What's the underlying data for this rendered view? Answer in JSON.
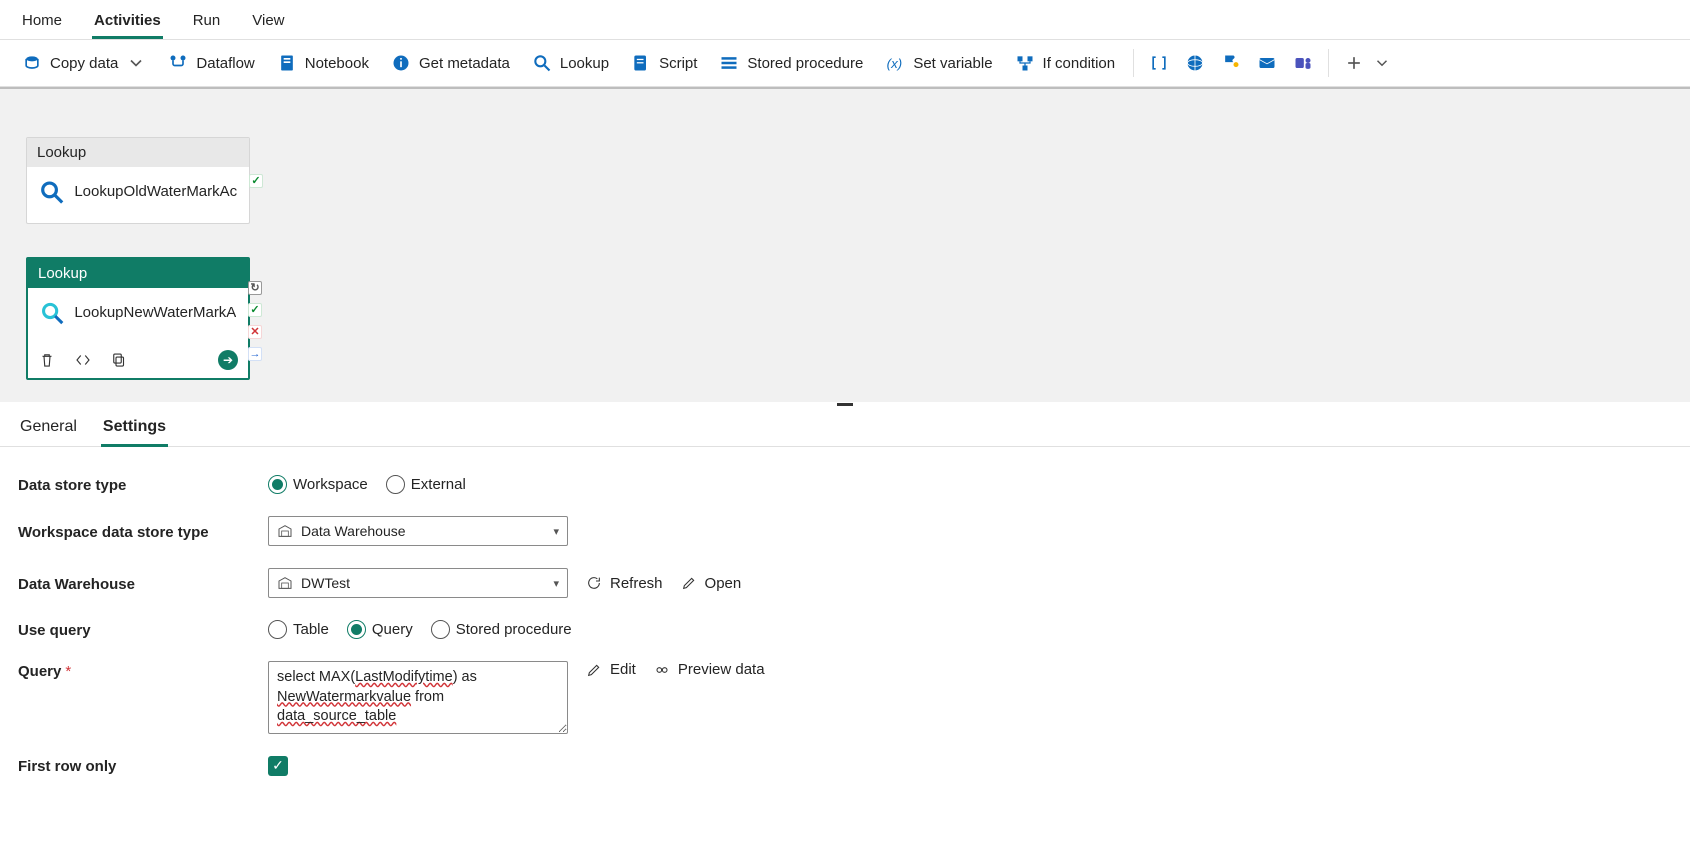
{
  "topTabs": {
    "home": "Home",
    "activities": "Activities",
    "run": "Run",
    "view": "View",
    "active": "activities"
  },
  "toolbar": {
    "copy_data": "Copy data",
    "dataflow": "Dataflow",
    "notebook": "Notebook",
    "get_metadata": "Get metadata",
    "lookup": "Lookup",
    "script": "Script",
    "stored_procedure": "Stored procedure",
    "set_variable": "Set variable",
    "if_condition": "If condition"
  },
  "canvas": {
    "card1": {
      "type": "Lookup",
      "name": "LookupOldWaterMarkActivity"
    },
    "card2": {
      "type": "Lookup",
      "name": "LookupNewWaterMarkActivity"
    }
  },
  "propTabs": {
    "general": "General",
    "settings": "Settings",
    "active": "settings"
  },
  "form": {
    "labels": {
      "data_store_type": "Data store type",
      "workspace_data_store_type": "Workspace data store type",
      "data_warehouse": "Data Warehouse",
      "use_query": "Use query",
      "query": "Query",
      "first_row_only": "First row only"
    },
    "radios": {
      "workspace": "Workspace",
      "external": "External",
      "table": "Table",
      "query": "Query",
      "stored_procedure": "Stored procedure"
    },
    "selects": {
      "workspace_type": "Data Warehouse",
      "warehouse_name": "DWTest"
    },
    "actions": {
      "refresh": "Refresh",
      "open": "Open",
      "edit": "Edit",
      "preview": "Preview data"
    },
    "query_text": {
      "l1a": "select MAX(",
      "l1b": "LastModifytime",
      "l1c": ") as",
      "l2a": "NewWatermarkvalue",
      "l2b": " from",
      "l3": "data_source_table"
    },
    "first_row_only_checked": true
  }
}
